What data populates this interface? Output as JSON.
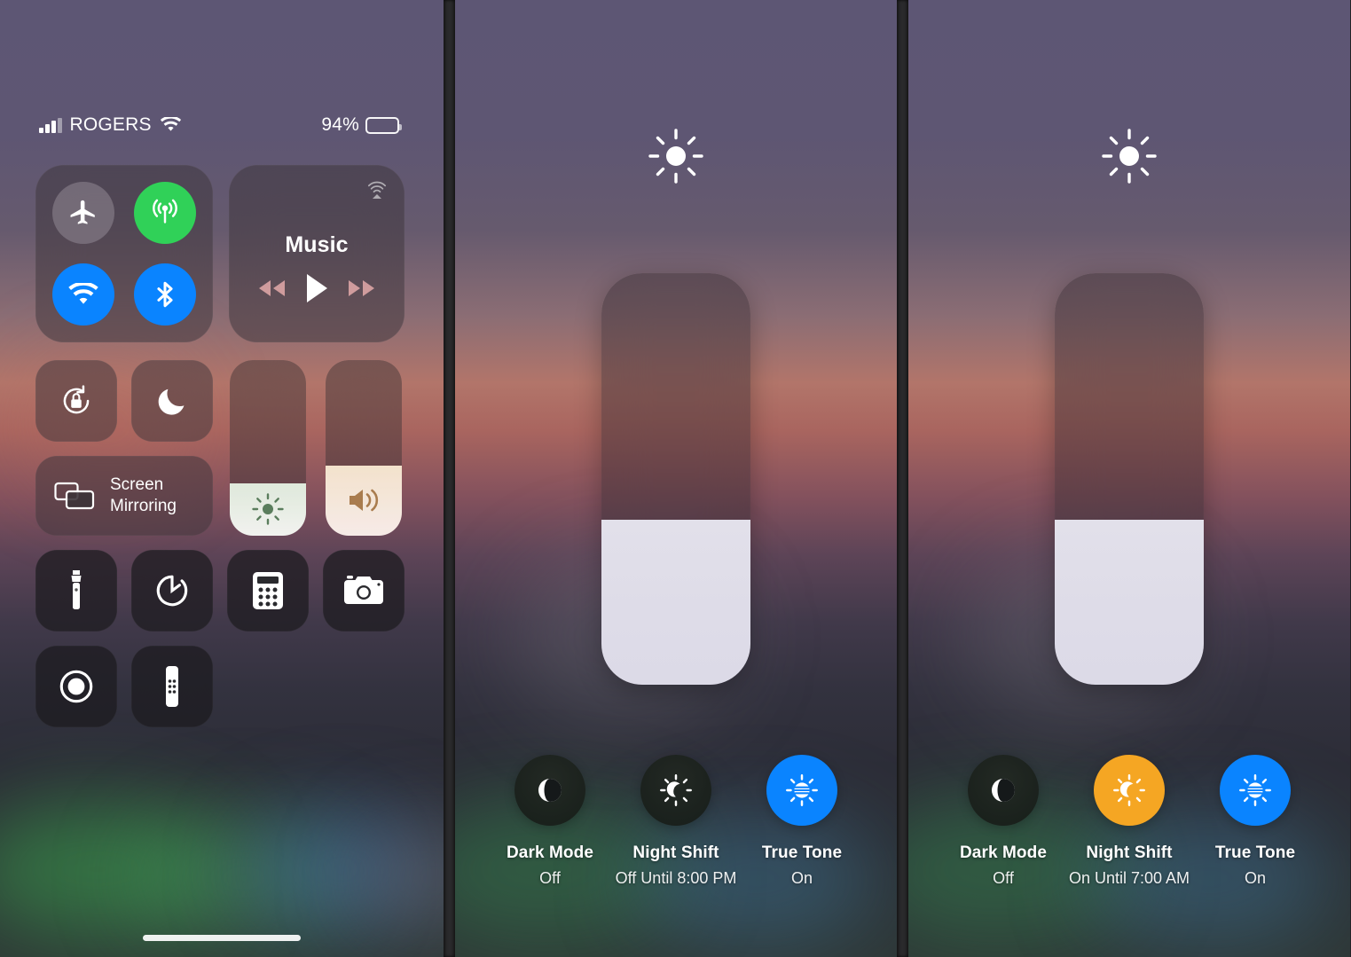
{
  "device": {
    "status_bar": {
      "carrier": "ROGERS",
      "signal_icon": "cellular-bars-icon",
      "wifi_icon": "wifi-icon",
      "battery_percent": "94%",
      "battery_icon": "battery-icon",
      "battery_level": 94
    },
    "home_indicator": "home-indicator"
  },
  "control_center": {
    "connectivity": {
      "airplane_mode": {
        "icon": "airplane-icon",
        "state": "off",
        "color": "#8a828c"
      },
      "cellular_data": {
        "icon": "cellular-antenna-icon",
        "state": "on",
        "color": "#30d158"
      },
      "wifi": {
        "icon": "wifi-icon",
        "state": "on",
        "color": "#0a84ff"
      },
      "bluetooth": {
        "icon": "bluetooth-icon",
        "state": "on",
        "color": "#0a84ff"
      }
    },
    "music": {
      "title": "Music",
      "airplay_icon": "airplay-icon",
      "rewind_icon": "rewind-icon",
      "play_icon": "play-icon",
      "forward_icon": "fast-forward-icon"
    },
    "rotation_lock": {
      "icon": "rotation-lock-icon",
      "state": "off"
    },
    "do_not_disturb": {
      "icon": "moon-icon",
      "state": "off"
    },
    "screen_mirroring": {
      "label_line1": "Screen",
      "label_line2": "Mirroring",
      "icon": "screen-mirroring-icon"
    },
    "brightness_slider": {
      "icon": "brightness-sun-icon",
      "value_percent": 30
    },
    "volume_slider": {
      "icon": "speaker-waves-icon",
      "value_percent": 40
    },
    "shortcuts": [
      {
        "name": "flashlight",
        "icon": "flashlight-icon"
      },
      {
        "name": "timer",
        "icon": "timer-icon"
      },
      {
        "name": "calculator",
        "icon": "calculator-icon"
      },
      {
        "name": "camera",
        "icon": "camera-icon"
      },
      {
        "name": "screen-recording",
        "icon": "record-icon"
      },
      {
        "name": "apple-tv-remote",
        "icon": "remote-icon"
      }
    ]
  },
  "brightness_panel_middle": {
    "sun_icon": "sun-icon",
    "slider": {
      "value_percent": 40
    },
    "toggles": [
      {
        "name": "Dark Mode",
        "state": "Off",
        "icon": "dark-mode-icon",
        "active": false,
        "color": "#1b2420"
      },
      {
        "name": "Night Shift",
        "state": "Off Until 8:00 PM",
        "icon": "night-shift-icon",
        "active": false,
        "color": "#1b2420"
      },
      {
        "name": "True Tone",
        "state": "On",
        "icon": "true-tone-icon",
        "active": true,
        "color": "#0a84ff"
      }
    ]
  },
  "brightness_panel_right": {
    "sun_icon": "sun-icon",
    "slider": {
      "value_percent": 40
    },
    "toggles": [
      {
        "name": "Dark Mode",
        "state": "Off",
        "icon": "dark-mode-icon",
        "active": false,
        "color": "#1b2420"
      },
      {
        "name": "Night Shift",
        "state": "On Until 7:00 AM",
        "icon": "night-shift-icon",
        "active": true,
        "color": "#f5a623"
      },
      {
        "name": "True Tone",
        "state": "On",
        "icon": "true-tone-icon",
        "active": true,
        "color": "#0a84ff"
      }
    ]
  }
}
